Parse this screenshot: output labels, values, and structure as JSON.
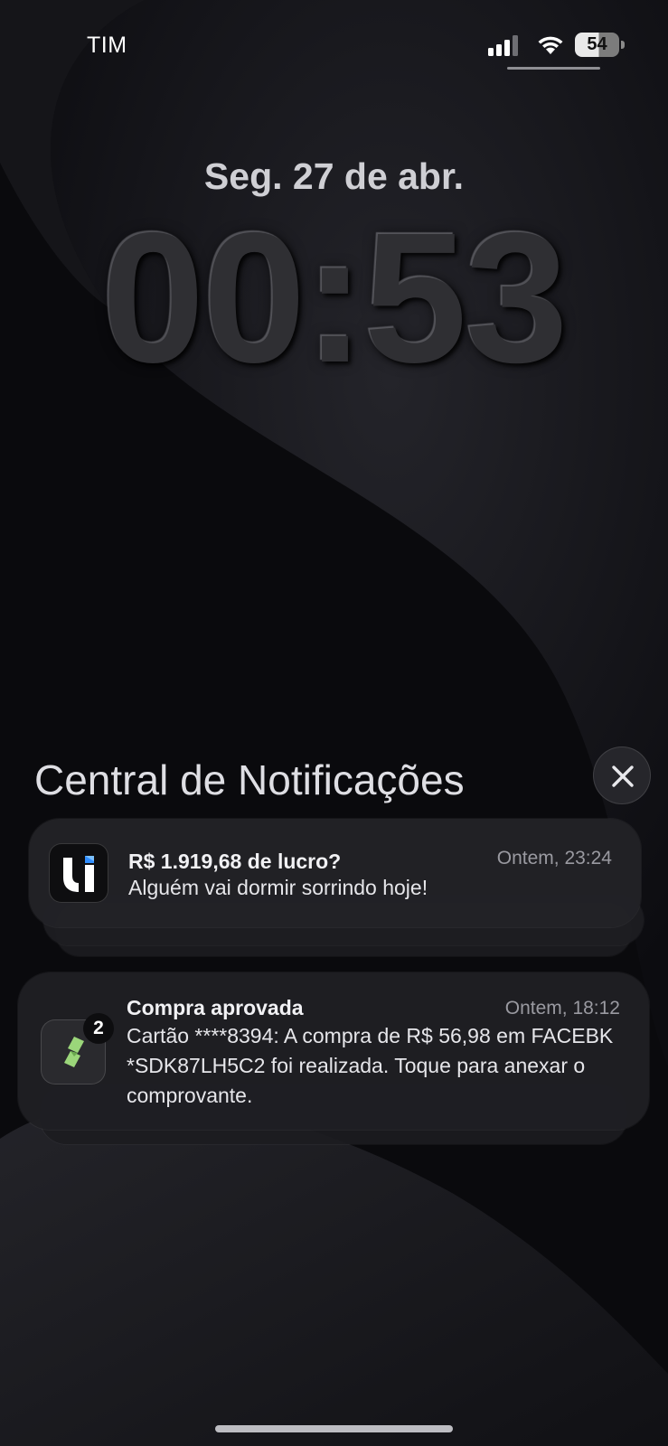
{
  "status_bar": {
    "carrier": "TIM",
    "signal_icon": "cellular-signal-icon",
    "wifi_icon": "wifi-icon",
    "battery_level": "54",
    "battery_fraction": 0.54
  },
  "lock_screen": {
    "date": "Seg. 27 de abr.",
    "time": "00:53"
  },
  "notification_center": {
    "title": "Central de Notificações",
    "close_icon": "close-icon"
  },
  "notifications": [
    {
      "app_icon": "u-app-icon",
      "title": "R$ 1.919,68 de lucro?",
      "time": "Ontem, 23:24",
      "body": "Alguém vai dormir sorrindo hoje!"
    },
    {
      "app_icon": "bank-app-icon",
      "badge": "2",
      "title": "Compra aprovada",
      "time": "Ontem, 18:12",
      "body": "Cartão ****8394: A compra de R$ 56,98 em FACEBK *SDK87LH5C2 foi realizada. Toque para anexar o comprovante."
    }
  ],
  "colors": {
    "background": "#0b0b0e",
    "card": "#222226",
    "accent_blue": "#2f8dff",
    "accent_green": "#9bd67a"
  }
}
